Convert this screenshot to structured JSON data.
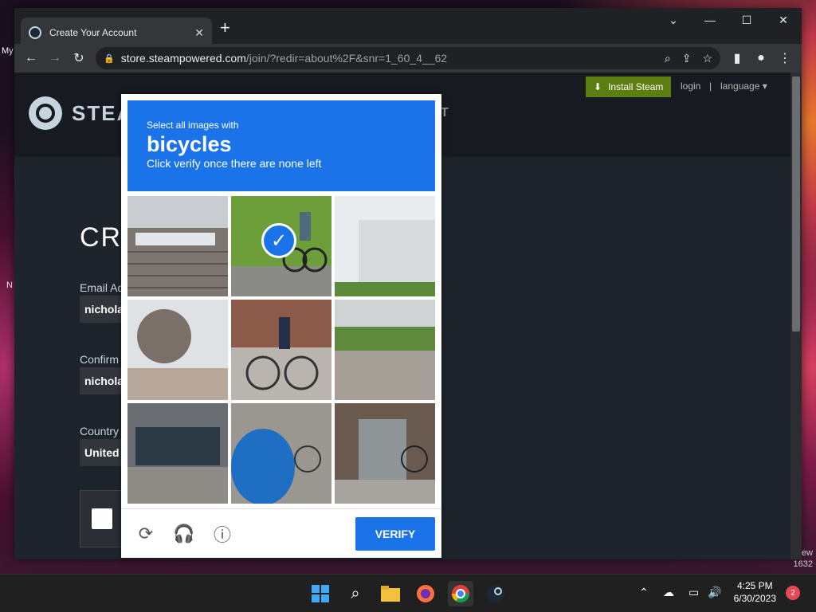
{
  "desktop": {
    "my_label": "My",
    "n_label": "N",
    "wm1": "ew",
    "wm2": "1632"
  },
  "browser": {
    "tab_title": "Create Your Account",
    "url_host": "store.steampowered.com",
    "url_path": "/join/?redir=about%2F&snr=1_60_4__62"
  },
  "steam": {
    "brand": "STEAM",
    "install_label": "Install Steam",
    "login_label": "login",
    "separator": "|",
    "language_label": "language",
    "nav_fragment": "T",
    "page_title": "CRE",
    "email_label": "Email Ad",
    "email_value": "nichola",
    "confirm_label": "Confirm",
    "confirm_value": "nichola",
    "country_label": "Country",
    "country_value": "United"
  },
  "captcha": {
    "instruction_top": "Select all images with",
    "target": "bicycles",
    "instruction_bottom": "Click verify once there are none left",
    "verify_label": "VERIFY",
    "tiles": [
      {
        "subject": "metal-bridge",
        "selected": false
      },
      {
        "subject": "cyclist-on-path",
        "selected": true
      },
      {
        "subject": "white-building",
        "selected": false
      },
      {
        "subject": "bare-tree-houses",
        "selected": false
      },
      {
        "subject": "woman-on-bicycle",
        "selected": false
      },
      {
        "subject": "park-lawn",
        "selected": false
      },
      {
        "subject": "storefront-parking",
        "selected": false
      },
      {
        "subject": "blue-tarp-bicycles",
        "selected": false
      },
      {
        "subject": "bicycle-by-box",
        "selected": false
      }
    ]
  },
  "taskbar": {
    "time": "4:25 PM",
    "date": "6/30/2023",
    "notifications": "2"
  }
}
